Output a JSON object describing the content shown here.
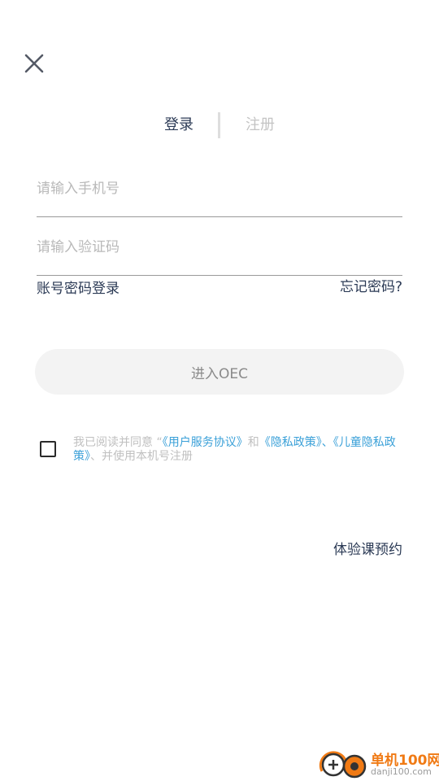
{
  "tabs": {
    "login": "登录",
    "register": "注册"
  },
  "form": {
    "phone_placeholder": "请输入手机号",
    "code_placeholder": "请输入验证码"
  },
  "links": {
    "password_login": "账号密码登录",
    "forgot_password": "忘记密码?"
  },
  "enter_button_label": "进入OEC",
  "agreement": {
    "checked": false,
    "prefix": "我已阅读并同意 “",
    "user_agreement": "《用户服务协议》",
    "and": "和",
    "privacy_policy": "《隐私政策》",
    "separator": "、",
    "children_privacy_policy": "《儿童隐私政策》",
    "suffix": "、并使用本机号注册"
  },
  "trial_booking": "体验课预约",
  "watermark": {
    "name": "单机100网",
    "domain": "danji100.com"
  },
  "colors": {
    "primary_text": "#2b3a55",
    "link": "#3aa0d8",
    "placeholder": "#b9b9b9",
    "button_bg": "#f3f3f3"
  }
}
